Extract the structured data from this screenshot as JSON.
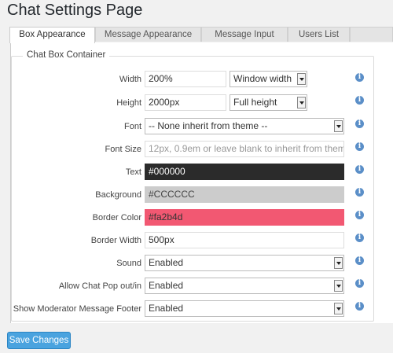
{
  "page_title": "Chat Settings Page",
  "tabs": [
    {
      "label": "Box Appearance"
    },
    {
      "label": "Message Appearance"
    },
    {
      "label": "Message Input"
    },
    {
      "label": "Users List"
    }
  ],
  "fieldset_legend": "Chat Box Container",
  "fields": {
    "width": {
      "label": "Width",
      "value": "200%",
      "unit": "Window width"
    },
    "height": {
      "label": "Height",
      "value": "2000px",
      "unit": "Full height"
    },
    "font": {
      "label": "Font",
      "value": "-- None inherit from theme --"
    },
    "font_size": {
      "label": "Font Size",
      "placeholder": "12px, 0.9em or leave blank to inherit from theme"
    },
    "text": {
      "label": "Text",
      "value": "#000000",
      "color": "#2b2b2b",
      "text_color": "#ffffff"
    },
    "background": {
      "label": "Background",
      "value": "#CCCCCC",
      "color": "#cccccc",
      "text_color": "#444444"
    },
    "border_color": {
      "label": "Border Color",
      "value": "#fa2b4d",
      "color": "#f25872",
      "text_color": "#333333"
    },
    "border_width": {
      "label": "Border Width",
      "value": "500px"
    },
    "sound": {
      "label": "Sound",
      "value": "Enabled"
    },
    "popout": {
      "label": "Allow Chat Pop out/in",
      "value": "Enabled"
    },
    "moderator_footer": {
      "label": "Show Moderator Message Footer",
      "value": "Enabled"
    }
  },
  "info_icon": "i",
  "save_button": "Save Changes"
}
